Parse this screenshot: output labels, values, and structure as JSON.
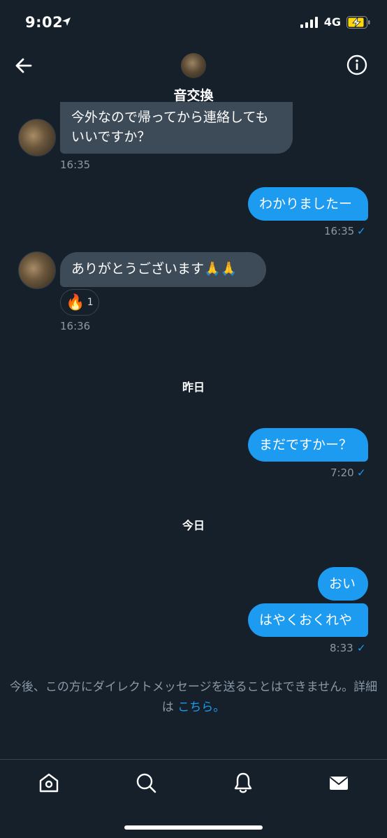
{
  "status": {
    "time": "9:02",
    "network": "4G"
  },
  "header": {
    "title": "音交換"
  },
  "messages": {
    "m1": {
      "text_line1": "今外なので帰ってから連絡しても",
      "text_line2": "いいですか？",
      "time": "16:35"
    },
    "m2": {
      "text": "わかりましたー",
      "time": "16:35"
    },
    "m3": {
      "text": "ありがとうございます🙏🙏",
      "time": "16:36",
      "reaction_emoji": "🔥",
      "reaction_count": "1"
    },
    "day1": "昨日",
    "m4": {
      "text": "まだですかー？",
      "time": "7:20"
    },
    "day2": "今日",
    "m5": {
      "text": "おい"
    },
    "m6": {
      "text": "はやくおくれや",
      "time": "8:33"
    }
  },
  "notice": {
    "text": "今後、この方にダイレクトメッセージを送ることはできません。詳細は ",
    "link": "こちら。"
  },
  "nav": [
    "home-icon",
    "search-icon",
    "notifications-icon",
    "messages-icon"
  ],
  "colors": {
    "background": "#15202b",
    "incoming_bubble": "#3d4a57",
    "outgoing_bubble": "#1d9bf0",
    "meta_text": "#8b98a5"
  }
}
